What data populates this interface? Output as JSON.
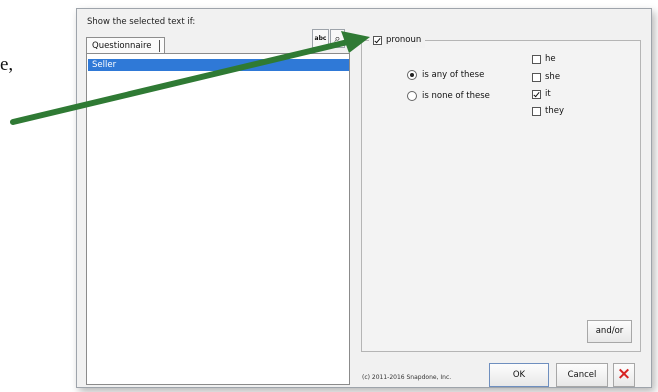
{
  "document": {
    "fragment": "e,"
  },
  "dialog": {
    "prompt": "Show the selected text if:",
    "tab_label": "Questionnaire",
    "selected_item": "Seller",
    "abc_button": "abc",
    "search_button_icon": "search-icon",
    "condition_label": "pronoun",
    "radio_options": {
      "any": "is any of these",
      "none": "is none of these"
    },
    "options": [
      {
        "label": "he",
        "checked": false
      },
      {
        "label": "she",
        "checked": false
      },
      {
        "label": "it",
        "checked": true
      },
      {
        "label": "they",
        "checked": false
      }
    ],
    "andor_button": "and/or",
    "ok_button": "OK",
    "cancel_button": "Cancel",
    "close_button": "×",
    "copyright": "(c) 2011-2016 Snapdone, Inc."
  },
  "colors": {
    "selection_blue": "#2f79d7",
    "arrow_green": "#2f7a34",
    "close_red": "#d72222"
  }
}
